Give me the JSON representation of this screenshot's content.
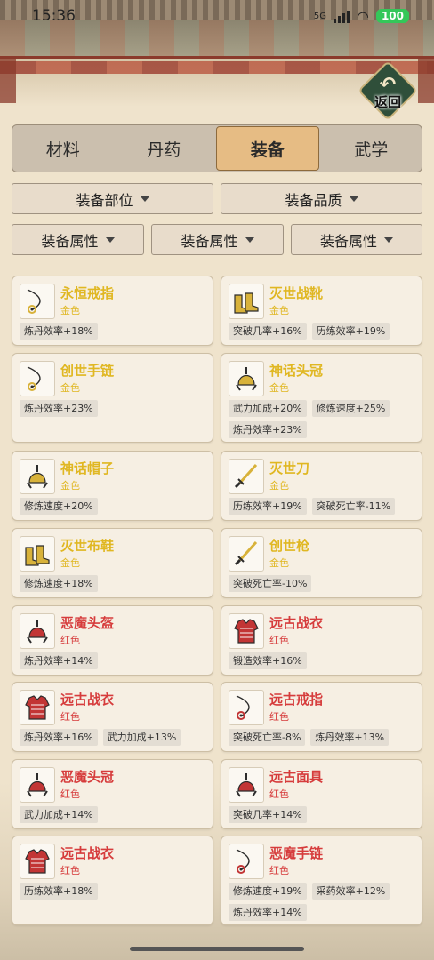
{
  "status": {
    "time": "15:36",
    "network": "5G",
    "battery": "100"
  },
  "back_label": "返回",
  "tabs": [
    {
      "label": "材料",
      "active": false
    },
    {
      "label": "丹药",
      "active": false
    },
    {
      "label": "装备",
      "active": true
    },
    {
      "label": "武学",
      "active": false
    }
  ],
  "filters": {
    "slot": "装备部位",
    "quality": "装备品质",
    "attr1": "装备属性",
    "attr2": "装备属性",
    "attr3": "装备属性"
  },
  "colors": {
    "gold": "#e0b722",
    "red": "#d63c3c",
    "active_tab": "#e6bc84"
  },
  "items": [
    {
      "name": "永恒戒指",
      "grade": "金色",
      "tier": "gold",
      "icon": "ring-icon",
      "stats": [
        "炼丹效率+18%"
      ]
    },
    {
      "name": "灭世战靴",
      "grade": "金色",
      "tier": "gold",
      "icon": "boots-icon",
      "stats": [
        "突破几率+16%",
        "历练效率+19%"
      ]
    },
    {
      "name": "创世手链",
      "grade": "金色",
      "tier": "gold",
      "icon": "bracelet-icon",
      "stats": [
        "炼丹效率+23%"
      ]
    },
    {
      "name": "神话头冠",
      "grade": "金色",
      "tier": "gold",
      "icon": "helmet-icon",
      "stats": [
        "武力加成+20%",
        "修炼速度+25%",
        "炼丹效率+23%"
      ]
    },
    {
      "name": "神话帽子",
      "grade": "金色",
      "tier": "gold",
      "icon": "hat-icon",
      "stats": [
        "修炼速度+20%"
      ]
    },
    {
      "name": "灭世刀",
      "grade": "金色",
      "tier": "gold",
      "icon": "blade-icon",
      "stats": [
        "历练效率+19%",
        "突破死亡率-11%"
      ]
    },
    {
      "name": "灭世布鞋",
      "grade": "金色",
      "tier": "gold",
      "icon": "shoes-icon",
      "stats": [
        "修炼速度+18%"
      ]
    },
    {
      "name": "创世枪",
      "grade": "金色",
      "tier": "gold",
      "icon": "spear-icon",
      "stats": [
        "突破死亡率-10%"
      ]
    },
    {
      "name": "恶魔头盔",
      "grade": "红色",
      "tier": "red",
      "icon": "helmet-icon",
      "stats": [
        "炼丹效率+14%"
      ]
    },
    {
      "name": "远古战衣",
      "grade": "红色",
      "tier": "red",
      "icon": "armor-icon",
      "stats": [
        "锻造效率+16%"
      ]
    },
    {
      "name": "远古战衣",
      "grade": "红色",
      "tier": "red",
      "icon": "armor-icon",
      "stats": [
        "炼丹效率+16%",
        "武力加成+13%"
      ]
    },
    {
      "name": "远古戒指",
      "grade": "红色",
      "tier": "red",
      "icon": "ring-icon",
      "stats": [
        "突破死亡率-8%",
        "炼丹效率+13%"
      ]
    },
    {
      "name": "恶魔头冠",
      "grade": "红色",
      "tier": "red",
      "icon": "helmet-icon",
      "stats": [
        "武力加成+14%"
      ]
    },
    {
      "name": "远古面具",
      "grade": "红色",
      "tier": "red",
      "icon": "mask-icon",
      "stats": [
        "突破几率+14%"
      ]
    },
    {
      "name": "远古战衣",
      "grade": "红色",
      "tier": "red",
      "icon": "armor-icon",
      "stats": [
        "历练效率+18%"
      ]
    },
    {
      "name": "恶魔手链",
      "grade": "红色",
      "tier": "red",
      "icon": "bracelet-icon",
      "stats": [
        "修炼速度+19%",
        "采药效率+12%",
        "炼丹效率+14%"
      ]
    }
  ]
}
